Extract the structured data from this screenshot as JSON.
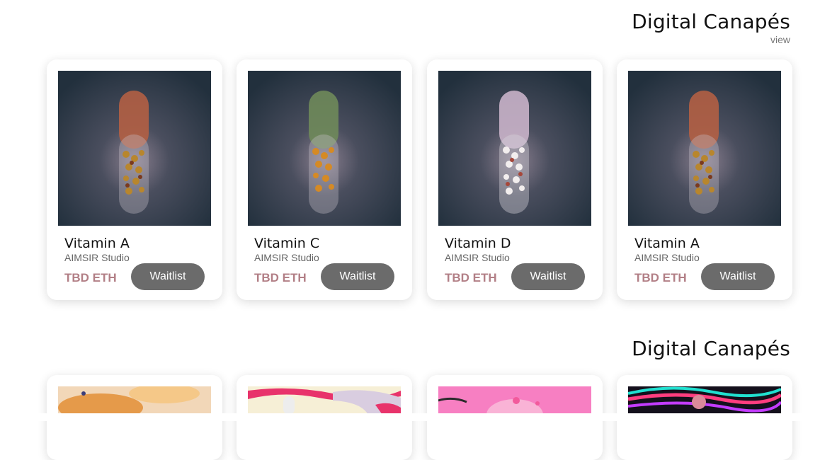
{
  "sections": [
    {
      "title": "Digital Canapés",
      "view_label": "view",
      "cards": [
        {
          "title": "Vitamin A",
          "studio": "AIMSIR Studio",
          "price": "TBD ETH",
          "button": "Waitlist",
          "pill_color": "#b35f44",
          "fill": "gold"
        },
        {
          "title": "Vitamin C",
          "studio": "AIMSIR Studio",
          "price": "TBD ETH",
          "button": "Waitlist",
          "pill_color": "#6f8a5a",
          "fill": "orange"
        },
        {
          "title": "Vitamin D",
          "studio": "AIMSIR Studio",
          "price": "TBD ETH",
          "button": "Waitlist",
          "pill_color": "#c9b3c9",
          "fill": "white"
        },
        {
          "title": "Vitamin A",
          "studio": "AIMSIR Studio",
          "price": "TBD ETH",
          "button": "Waitlist",
          "pill_color": "#b35f44",
          "fill": "gold"
        }
      ]
    },
    {
      "title": "Digital Canapés",
      "cards": [
        {
          "theme": "orange-abstract"
        },
        {
          "theme": "pink-cream-abstract"
        },
        {
          "theme": "pink-bubbles"
        },
        {
          "theme": "neon-dark"
        }
      ]
    }
  ],
  "colors": {
    "price": "#b27f86",
    "button": "#6b6b6b",
    "thumb_bg": "#2a3a48"
  }
}
